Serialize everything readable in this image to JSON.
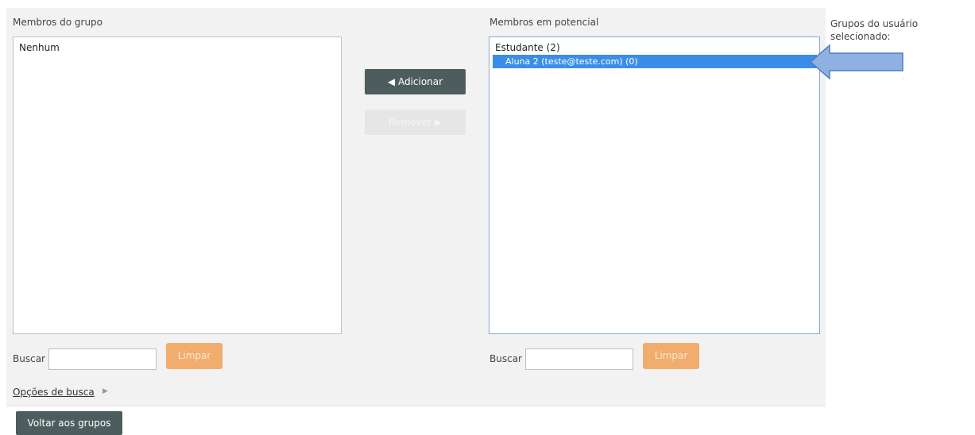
{
  "group_members": {
    "label": "Membros do grupo",
    "empty_option": "Nenhum",
    "search_label": "Buscar",
    "search_value": "",
    "clear_label": "Limpar"
  },
  "actions": {
    "add_label": "◀ Adicionar",
    "remove_label": "Remover ▶"
  },
  "potential_members": {
    "label": "Membros em potencial",
    "group_label": "Estudante (2)",
    "selected_option": "Aluna 2 (teste@teste.com) (0)",
    "search_label": "Buscar",
    "search_value": "",
    "clear_label": "Limpar"
  },
  "user_groups": {
    "label_line1": "Grupos do usuário",
    "label_line2": "selecionado:"
  },
  "search_options": {
    "label": "Opções de busca",
    "caret": "▶"
  },
  "back_button": {
    "label": "Voltar aos grupos"
  },
  "colors": {
    "accent_selected": "#3b8ee8",
    "primary_button": "#4d5d5d",
    "clear_button": "#f0ad6e",
    "arrow_fill": "#8fb0e0",
    "arrow_stroke": "#4f7fbf"
  }
}
